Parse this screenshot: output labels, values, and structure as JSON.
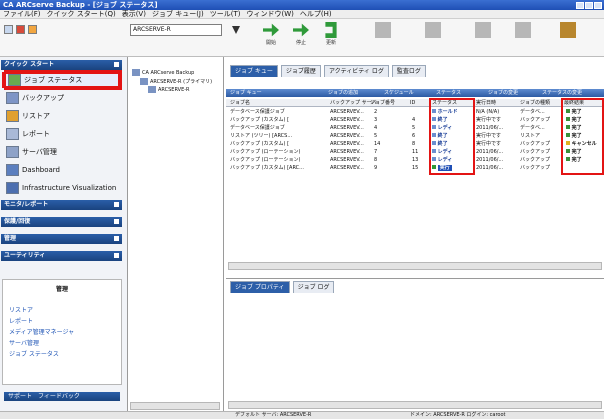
{
  "window": {
    "title": "CA ARCserve Backup - [ジョブ ステータス]"
  },
  "menubar": [
    "ファイル(F)",
    "クイック スタート(Q)",
    "表示(V)",
    "ジョブ キュー(J)",
    "ツール(T)",
    "ウィンドウ(W)",
    "ヘルプ(H)"
  ],
  "toolbar": {
    "server_select": "ARCSERVE-R",
    "buttons": [
      "開始",
      "停止",
      "更新"
    ]
  },
  "left_nav": {
    "sections": [
      "クイック スタート",
      "モニタ/レポート",
      "保護/回復",
      "管理",
      "ユーティリティ"
    ],
    "items": [
      "ジョブ ステータス",
      "バックアップ",
      "リストア",
      "レポート",
      "サーバ管理",
      "Dashboard",
      "Infrastructure Visualization"
    ],
    "task_title": "管理",
    "task_links": [
      "リストア",
      "レポート",
      "メディア管理マネージャ",
      "サーバ管理",
      "ジョブ ステータス"
    ],
    "support": [
      "サポート",
      "フィードバック"
    ]
  },
  "tree": {
    "root": "CA ARCserve Backup",
    "children": [
      "ARCSERVE-R (プライマリ)",
      "ARCSERVE-R"
    ]
  },
  "tabs": [
    "ジョブ キュー",
    "ジョブ履歴",
    "アクティビティ ログ",
    "監査ログ"
  ],
  "grid": {
    "header_left": "ジョブ キュー",
    "header_right": [
      "ジョブの追加",
      "スケジュール",
      "ステータス",
      "ジョブの変更",
      "ステータスの変更"
    ],
    "columns": [
      "ジョブ名",
      "バックアップ サーバ",
      "ジョブ番号",
      "ID",
      "ステータス",
      "実行日時",
      "ジョブの種類",
      "最終結果"
    ],
    "rows": [
      {
        "name": "データベース保護ジョブ",
        "server": "ARCSERVEV...",
        "no": "2",
        "id": "",
        "status": "ホールド",
        "time": "N/A (N/A)",
        "type": "データベ...",
        "result": "完了"
      },
      {
        "name": "バックアップ (カスタム) [",
        "server": "ARCSERVEV...",
        "no": "3",
        "id": "4",
        "status": "終了",
        "time": "実行中です",
        "type": "バックアップ",
        "result": "完了"
      },
      {
        "name": "データベース保護ジョブ",
        "server": "ARCSERVEV...",
        "no": "4",
        "id": "5",
        "status": "レディ",
        "time": "2011/06/...",
        "type": "データベ...",
        "result": "完了"
      },
      {
        "name": "リストア (ツリー) [ARCS...",
        "server": "ARCSERVEV...",
        "no": "5",
        "id": "6",
        "status": "終了",
        "time": "実行中です",
        "type": "リストア",
        "result": "完了"
      },
      {
        "name": "バックアップ (カスタム) [",
        "server": "ARCSERVEV...",
        "no": "14",
        "id": "8",
        "status": "終了",
        "time": "実行中です",
        "type": "バックアップ",
        "result": "キャンセル"
      },
      {
        "name": "バックアップ (ローテーション)",
        "server": "ARCSERVEV...",
        "no": "7",
        "id": "11",
        "status": "レディ",
        "time": "2011/06/...",
        "type": "バックアップ",
        "result": "完了"
      },
      {
        "name": "バックアップ (ローテーション)",
        "server": "ARCSERVEV...",
        "no": "8",
        "id": "13",
        "status": "レディ",
        "time": "2011/06/...",
        "type": "バックアップ",
        "result": "完了"
      },
      {
        "name": "バックアップ (カスタム) [ARC...",
        "server": "ARCSERVEV...",
        "no": "9",
        "id": "15",
        "status": "実行",
        "time": "2011/06/...",
        "type": "バックアップ",
        "result": ""
      }
    ]
  },
  "lower_tabs": [
    "ジョブ プロパティ",
    "ジョブ ログ"
  ],
  "statusbar": {
    "left": "デフォルト サーバ: ARCSERVE-R",
    "right": "ドメイン: ARCSERVE-R  ログイン: caroot"
  }
}
